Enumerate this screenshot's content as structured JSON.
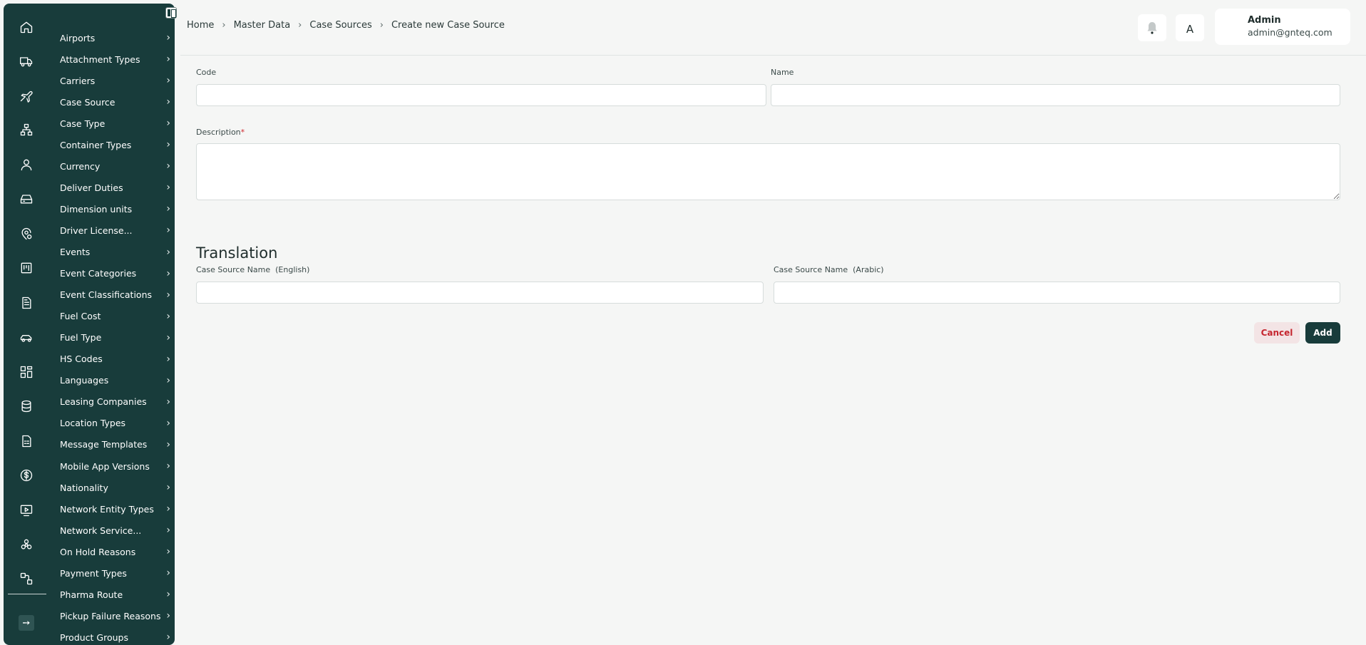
{
  "sidebar": {
    "menu": [
      {
        "label": "Airports"
      },
      {
        "label": "Attachment Types"
      },
      {
        "label": "Carriers"
      },
      {
        "label": "Case Source"
      },
      {
        "label": "Case Type"
      },
      {
        "label": "Container Types"
      },
      {
        "label": "Currency"
      },
      {
        "label": "Deliver Duties"
      },
      {
        "label": "Dimension units"
      },
      {
        "label": "Driver License..."
      },
      {
        "label": "Events"
      },
      {
        "label": "Event Categories"
      },
      {
        "label": "Event Classifications"
      },
      {
        "label": "Fuel Cost"
      },
      {
        "label": "Fuel Type"
      },
      {
        "label": "HS Codes"
      },
      {
        "label": "Languages"
      },
      {
        "label": "Leasing Companies"
      },
      {
        "label": "Location Types"
      },
      {
        "label": "Message Templates"
      },
      {
        "label": "Mobile App Versions"
      },
      {
        "label": "Nationality"
      },
      {
        "label": "Network Entity Types"
      },
      {
        "label": "Network Service..."
      },
      {
        "label": "On Hold Reasons"
      },
      {
        "label": "Payment Types"
      },
      {
        "label": "Pharma Route"
      },
      {
        "label": "Pickup Failure Reasons"
      },
      {
        "label": "Product Groups"
      }
    ],
    "rail_icons": [
      "home-icon",
      "truck-icon",
      "plane-icon",
      "network-icon",
      "user-icon",
      "inbox-icon",
      "location-icon",
      "board-icon",
      "document-icon",
      "car-icon",
      "dashboard-icon",
      "database-icon",
      "report-icon",
      "dollar-icon",
      "monitor-icon",
      "cluster-icon",
      "workflow-icon",
      "logout-icon"
    ]
  },
  "header": {
    "breadcrumb": [
      "Home",
      "Master Data",
      "Case Sources",
      "Create new Case Source"
    ],
    "breadcrumb_separator": "›",
    "lang_glyph": "A",
    "user": {
      "name": "Admin",
      "email": "admin@gnteq.com"
    }
  },
  "form": {
    "code": {
      "label": "Code",
      "value": ""
    },
    "name": {
      "label": "Name",
      "value": ""
    },
    "description": {
      "label": "Description",
      "required_mark": "*",
      "value": ""
    },
    "translation_title": "Translation",
    "name_en": {
      "label": "Case Source Name  (English)",
      "value": ""
    },
    "name_ar": {
      "label": "Case Source Name  (Arabic)",
      "value": ""
    },
    "cancel_label": "Cancel",
    "add_label": "Add"
  },
  "colors": {
    "sidebar_bg": "#183c3b",
    "primary": "#183c3b",
    "cancel_text": "#c5262f",
    "required": "#d0282e"
  }
}
